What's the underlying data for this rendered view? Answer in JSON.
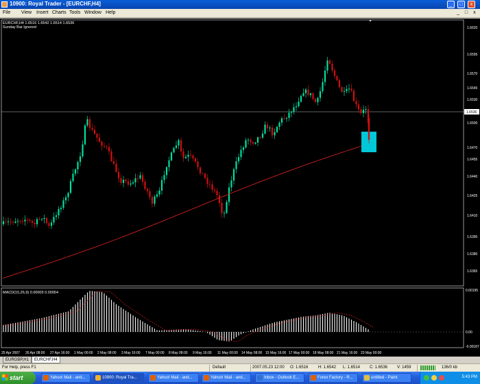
{
  "window": {
    "title": "10900: Royal Trader - [EURCHF,H4]",
    "minimize_label": "_",
    "maximize_label": "□",
    "close_label": "x"
  },
  "menu": [
    "File",
    "View",
    "Insert",
    "Charts",
    "Tools",
    "Window",
    "Help"
  ],
  "mdi_controls": [
    "_",
    "□",
    "x"
  ],
  "chart": {
    "header_line1": "EURCHF,H4  1.6516 1.6542 1.6514 1.6536",
    "header_line2": "Sunday Bar Ignored",
    "price_labels": [
      "1.6620",
      "1.6595",
      "1.6570",
      "1.6545",
      "1.6530",
      "1.6515",
      "1.6500",
      "1.6470",
      "1.6455",
      "1.6440",
      "1.6425",
      "1.6410",
      "1.6395",
      "1.6380",
      "1.6365"
    ],
    "current_price_label": "1.6536",
    "time_labels": [
      "25 Apr 2007",
      "26 Apr 08:00",
      "27 Apr 16:00",
      "1 May 00:00",
      "2 May 08:00",
      "3 May 16:00",
      "7 May 00:00",
      "8 May 08:00",
      "9 May 16:00",
      "11 May 00:00",
      "14 May 08:00",
      "15 May 16:00",
      "17 May 00:00",
      "18 May 08:00",
      "21 May 16:00",
      "23 May 00:00"
    ],
    "macd_header": "MACD(15,26,9) 0.00003 0.00054",
    "macd_labels": [
      "0.00195",
      "0.00",
      "-0.00187"
    ],
    "colors": {
      "background": "#000000",
      "bull": "#00e0a0",
      "bear": "#d01010",
      "ma": "#d02020",
      "macd_hist": "#ffffff",
      "macd_signal": "#d02020",
      "highlight": "#00c8d8"
    },
    "ma_note": "moving average line rising under price",
    "highlight_shape": "cyan rectangle on last candle"
  },
  "tabs": [
    "EURGBP,H1",
    "EURCHF,H4"
  ],
  "status": {
    "help": "For Help, press F1",
    "profile": "Default",
    "datetime": "2007.05.23 12:00",
    "open": "O: 1.6516",
    "high": "H: 1.6542",
    "low": "L: 1.6514",
    "close": "C: 1.6536",
    "volume": "V: 1459",
    "traffic": "136/0 kb"
  },
  "taskbar": {
    "start_label": "start",
    "buttons": [
      "Yahoo! Mail - and...",
      "10900: Royal Tra...",
      "Yahoo! Mail - and...",
      "Yahoo! Mail - and...",
      "Inbox - Outlook E...",
      "Forex Factory - R...",
      "untitled - Paint"
    ],
    "clock": "5:43 PM"
  }
}
